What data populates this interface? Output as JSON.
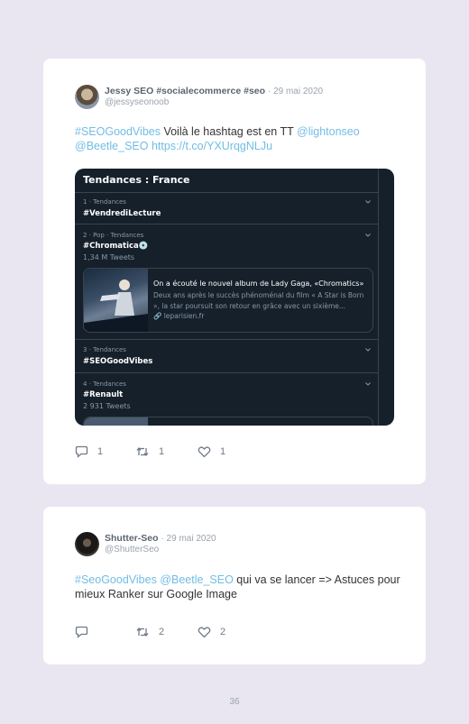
{
  "posts": [
    {
      "author": "Jessy SEO #socialecommerce #seo",
      "date": "· 29 mai 2020",
      "handle": "@jessyseonoob",
      "text": {
        "hashtag": "#SEOGoodVibes",
        "body": " Voilà le hashtag est en TT ",
        "mention1": "@lightonseo",
        "mention2": "@Beetle_SEO",
        "url": "https://t.co/YXUrqgNLJu"
      },
      "embed": {
        "header": "Tendances : France",
        "trends": [
          {
            "meta": "1 · Tendances",
            "tag": "#VendrediLecture",
            "count": ""
          },
          {
            "meta": "2 · Pop · Tendances",
            "tag": "#Chromatica",
            "emoji": "💿",
            "count": "1,34 M Tweets"
          },
          {
            "meta": "3 · Tendances",
            "tag": "#SEOGoodVibes",
            "count": ""
          },
          {
            "meta": "4 · Tendances",
            "tag": "#Renault",
            "count": "2 931 Tweets"
          }
        ],
        "news": {
          "title": "On a écouté le nouvel album de Lady Gaga, «Chromatics»",
          "body": "Deux ans après le succès phénoménal du film « A Star is Born », la star poursuit son retour en grâce avec un sixième...",
          "source": "🔗 leparisien.fr"
        }
      },
      "actions": {
        "replies": "1",
        "retweets": "1",
        "likes": "1"
      }
    },
    {
      "author": "Shutter-Seo",
      "date": "· 29 mai 2020",
      "handle": "@ShutterSeo",
      "text": {
        "hashtag": "#SeoGoodVibes",
        "mention": "@Beetle_SEO",
        "body": " qui va se lancer => Astuces pour mieux Ranker sur Google Image"
      },
      "actions": {
        "replies": "",
        "retweets": "2",
        "likes": "2"
      }
    }
  ],
  "page_number": "36",
  "colors": {
    "link": "#72bde4",
    "background": "#e9e6f2",
    "embed_bg": "#15202b"
  }
}
